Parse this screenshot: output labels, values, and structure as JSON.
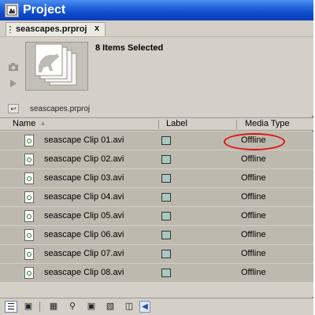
{
  "window": {
    "title": "Project",
    "icon": "project-panel-icon"
  },
  "tab": {
    "label": "seascapes.prproj",
    "close_glyph": "x"
  },
  "preview": {
    "selection_text": "8 Items Selected",
    "thumbnail_icon": "stacked-clips-icon",
    "poster_frame_icon": "camera-icon",
    "play_icon": "play-icon"
  },
  "path": {
    "up_icon": "folder-up-icon",
    "label": "seascapes.prproj"
  },
  "columns": {
    "name": "Name",
    "label": "Label",
    "media_type": "Media Type"
  },
  "clips": [
    {
      "name": "seascape Clip 01.avi",
      "media_type": "Offline"
    },
    {
      "name": "seascape Clip 02.avi",
      "media_type": "Offline"
    },
    {
      "name": "seascape Clip 03.avi",
      "media_type": "Offline"
    },
    {
      "name": "seascape Clip 04.avi",
      "media_type": "Offline"
    },
    {
      "name": "seascape Clip 05.avi",
      "media_type": "Offline"
    },
    {
      "name": "seascape Clip 06.avi",
      "media_type": "Offline"
    },
    {
      "name": "seascape Clip 07.avi",
      "media_type": "Offline"
    },
    {
      "name": "seascape Clip 08.avi",
      "media_type": "Offline"
    }
  ],
  "colors": {
    "title_bar": "#0b47c9",
    "row_selected": "#bdb9ae",
    "label_swatch": "#a9c8c0",
    "annotation": "#e01010"
  },
  "bottom_bar": {
    "icons": [
      "list-view-icon",
      "icon-view-icon",
      "storyboard-icon",
      "find-icon",
      "new-bin-icon",
      "new-item-icon",
      "trash-icon",
      "scroll-left-icon"
    ]
  }
}
